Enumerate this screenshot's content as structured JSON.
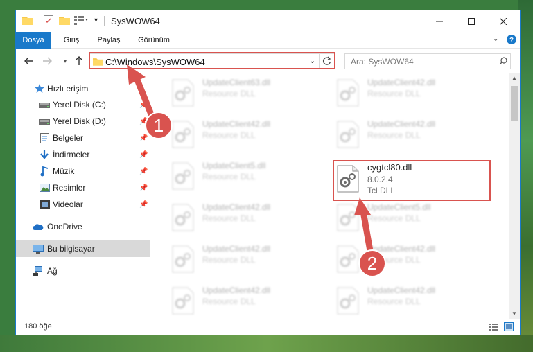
{
  "window": {
    "title": "SysWOW64",
    "controls": {
      "minimize": "minimize",
      "maximize": "maximize",
      "close": "close"
    }
  },
  "ribbon": {
    "tabs": [
      "Dosya",
      "Giriş",
      "Paylaş",
      "Görünüm"
    ]
  },
  "address": {
    "path": "C:\\Windows\\SysWOW64",
    "search_placeholder": "Ara: SysWOW64"
  },
  "nav": {
    "quick_access": "Hızlı erişim",
    "items": [
      {
        "label": "Yerel Disk (C:)",
        "icon": "drive-icon",
        "pinned": true
      },
      {
        "label": "Yerel Disk (D:)",
        "icon": "drive-icon",
        "pinned": true
      },
      {
        "label": "Belgeler",
        "icon": "documents-icon",
        "pinned": true
      },
      {
        "label": "İndirmeler",
        "icon": "download-icon",
        "pinned": true
      },
      {
        "label": "Müzik",
        "icon": "music-icon",
        "pinned": true
      },
      {
        "label": "Resimler",
        "icon": "pictures-icon",
        "pinned": true
      },
      {
        "label": "Videolar",
        "icon": "video-icon",
        "pinned": true
      }
    ],
    "onedrive": "OneDrive",
    "this_pc": "Bu bilgisayar",
    "network": "Ağ"
  },
  "files": [
    {
      "name": "UpdateClient63.dll",
      "desc": "Resource DLL",
      "blurred": true
    },
    {
      "name": "UpdateClient42.dll",
      "desc": "Resource DLL",
      "blurred": true
    },
    {
      "name": "UpdateClient42.dll",
      "desc": "Resource DLL",
      "blurred": true
    },
    {
      "name": "UpdateClient42.dll",
      "desc": "Resource DLL",
      "blurred": true
    },
    {
      "name": "UpdateClient5.dll",
      "desc": "Resource DLL",
      "blurred": true
    },
    {
      "name": "cygtcl80.dll",
      "version": "8.0.2.4",
      "desc": "Tcl DLL",
      "blurred": false
    },
    {
      "name": "UpdateClient42.dll",
      "desc": "Resource DLL",
      "blurred": true
    },
    {
      "name": "UpdateClient5.dll",
      "desc": "Resource DLL",
      "blurred": true
    },
    {
      "name": "UpdateClient42.dll",
      "desc": "Resource DLL",
      "blurred": true
    },
    {
      "name": "UpdateClient42.dll",
      "desc": "Resource DLL",
      "blurred": true
    },
    {
      "name": "UpdateClient42.dll",
      "desc": "Resource DLL",
      "blurred": true
    },
    {
      "name": "UpdateClient42.dll",
      "desc": "Resource DLL",
      "blurred": true
    }
  ],
  "status": {
    "item_count": "180 öğe"
  },
  "annotations": {
    "step1": "1",
    "step2": "2",
    "color": "#d9534f"
  },
  "colors": {
    "accent": "#1979ca",
    "selected_nav": "#d9d9d9"
  }
}
